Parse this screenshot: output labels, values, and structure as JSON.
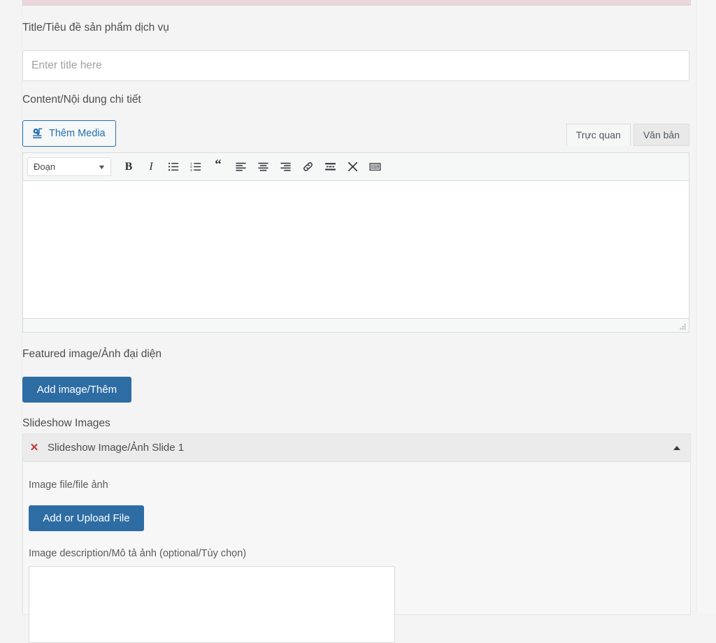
{
  "notice": {
    "visible": true,
    "color": "#ead7dc"
  },
  "theme": {
    "primary_button_bg": "#2e6da4",
    "link_blue": "#2271b1",
    "page_bg": "#f4f4f4",
    "panel_header_bg": "#ebebeb",
    "remove_icon_color": "#c0392b"
  },
  "title_field": {
    "label": "Title/Tiêu đề sản phẩm dịch vụ",
    "placeholder": "Enter title here",
    "value": ""
  },
  "content_field": {
    "label": "Content/Nội dung chi tiết",
    "add_media_label": "Thêm Media",
    "add_media_icon": "media-add-icon",
    "tabs": [
      {
        "label": "Trực quan",
        "active": true,
        "name": "tab-visual"
      },
      {
        "label": "Văn bản",
        "active": false,
        "name": "tab-text"
      }
    ],
    "format_select": {
      "value": "Đoạn",
      "caret_icon": "chevron-down-icon"
    },
    "toolbar_buttons": [
      {
        "name": "bold-icon",
        "title": "B"
      },
      {
        "name": "italic-icon",
        "title": "I"
      },
      {
        "name": "bulleted-list-icon",
        "title": ""
      },
      {
        "name": "numbered-list-icon",
        "title": ""
      },
      {
        "name": "blockquote-icon",
        "title": ""
      },
      {
        "name": "align-left-icon",
        "title": ""
      },
      {
        "name": "align-center-icon",
        "title": ""
      },
      {
        "name": "align-right-icon",
        "title": ""
      },
      {
        "name": "insert-link-icon",
        "title": ""
      },
      {
        "name": "read-more-icon",
        "title": ""
      },
      {
        "name": "toolbar-toggle-icon",
        "title": ""
      },
      {
        "name": "keyboard-shortcuts-icon",
        "title": ""
      }
    ],
    "editor_value": "",
    "resize_handle_icon": "resize-grip-icon"
  },
  "featured_image": {
    "label": "Featured image/Ảnh đại diện",
    "button_label": "Add image/Thêm"
  },
  "slideshow": {
    "label": "Slideshow Images",
    "items": [
      {
        "remove_icon": "remove-x-icon",
        "title": "Slideshow Image/Ảnh Slide 1",
        "toggle_icon": "triangle-up-icon",
        "file_label": "Image file/file ảnh",
        "upload_button_label": "Add or Upload File",
        "description_label": "Image description/Mô tả ảnh (optional/Tùy chọn)",
        "description_value": ""
      }
    ]
  }
}
